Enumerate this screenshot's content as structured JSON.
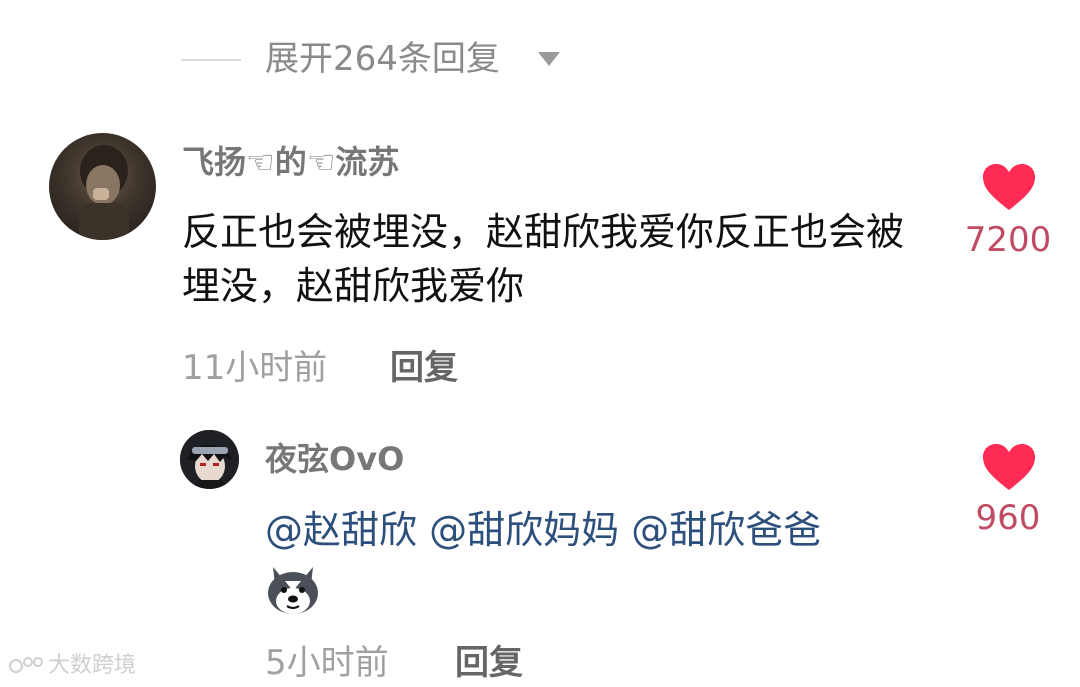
{
  "expand": {
    "label": "展开264条回复",
    "icon": "caret-down-icon"
  },
  "comments": [
    {
      "username": "飞扬☜的☜流苏",
      "text": "反正也会被埋没，赵甜欣我爱你反正也会被埋没，赵甜欣我爱你",
      "time": "11小时前",
      "reply_label": "回复",
      "likes": "7200",
      "heart_color": "#fe2c55"
    },
    {
      "username": "夜弦OvO",
      "mentions": [
        "@赵甜欣",
        "@甜欣妈妈",
        "@甜欣爸爸"
      ],
      "emoji": "husky-dog-emoji",
      "time": "5小时前",
      "reply_label": "回复",
      "likes": "960",
      "heart_color": "#fe2c55"
    }
  ],
  "watermark": {
    "text": "大数跨境"
  },
  "colors": {
    "mention": "#2d4f7c",
    "likes": "#c04c63",
    "muted": "#a0a0a0"
  }
}
